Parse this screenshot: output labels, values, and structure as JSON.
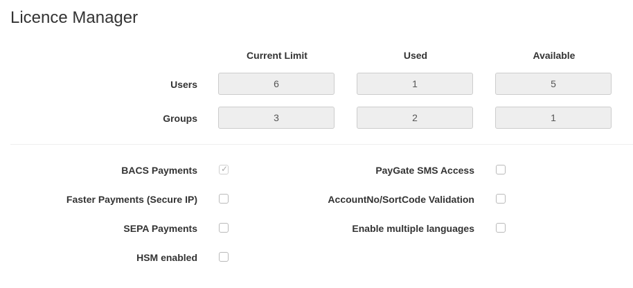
{
  "title": "Licence Manager",
  "limits_table": {
    "columns": [
      "Current Limit",
      "Used",
      "Available"
    ],
    "rows": [
      {
        "label": "Users",
        "values": [
          "6",
          "1",
          "5"
        ]
      },
      {
        "label": "Groups",
        "values": [
          "3",
          "2",
          "1"
        ]
      }
    ]
  },
  "features": {
    "left": [
      {
        "label": "BACS Payments",
        "checked": true
      },
      {
        "label": "Faster Payments (Secure IP)",
        "checked": false
      },
      {
        "label": "SEPA Payments",
        "checked": false
      },
      {
        "label": "HSM enabled",
        "checked": false
      }
    ],
    "right": [
      {
        "label": "PayGate SMS Access",
        "checked": false
      },
      {
        "label": "AccountNo/SortCode Validation",
        "checked": false
      },
      {
        "label": "Enable multiple languages",
        "checked": false
      }
    ]
  },
  "icons": {
    "check_mark": "✓"
  }
}
